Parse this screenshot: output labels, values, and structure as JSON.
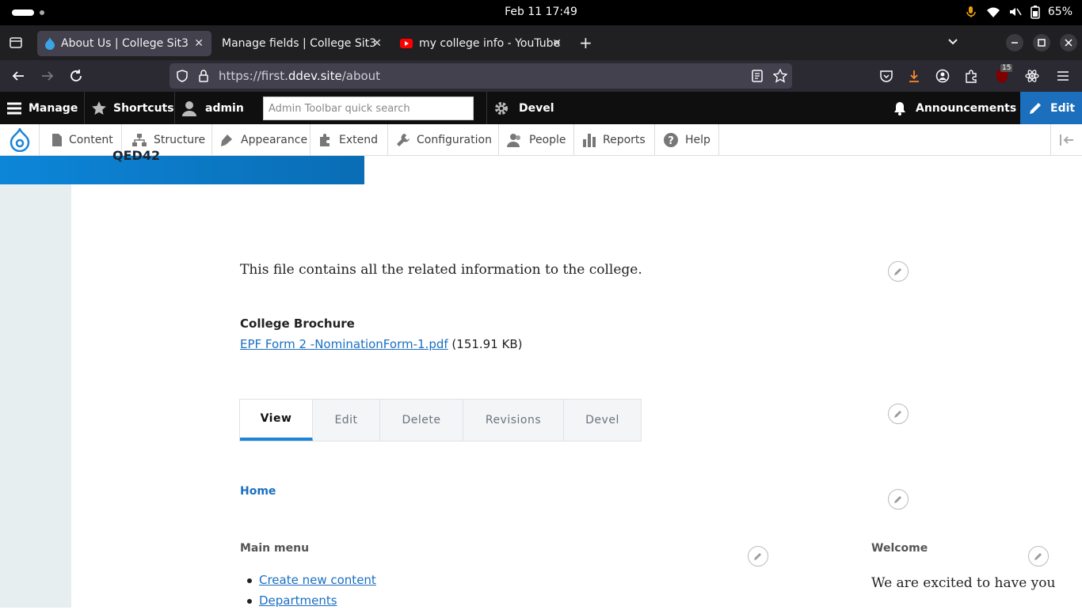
{
  "system": {
    "clock": "Feb 11  17:49",
    "battery": "65%"
  },
  "browser": {
    "tabs": [
      {
        "title": "About Us | College Sit3",
        "active": true
      },
      {
        "title": "Manage fields | College Sit3",
        "active": false
      },
      {
        "title": "my college info - YouTube",
        "active": false
      }
    ],
    "url_prefix": "https://first.",
    "url_host": "ddev.site",
    "url_path": "/about",
    "extension_badge": "15"
  },
  "toolbar": {
    "manage": "Manage",
    "shortcuts": "Shortcuts",
    "user": "admin",
    "search_placeholder": "Admin Toolbar quick search",
    "devel": "Devel",
    "announcements": "Announcements",
    "edit": "Edit"
  },
  "admin_menu": [
    "Content",
    "Structure",
    "Appearance",
    "Extend",
    "Configuration",
    "People",
    "Reports",
    "Help"
  ],
  "page": {
    "banner_text": "QED42",
    "body_text": "This file contains all the related information to the college.",
    "field_label": "College Brochure",
    "file_link": "EPF Form 2 -NominationForm-1.pdf",
    "file_size": "(151.91 KB)",
    "local_tabs": [
      "View",
      "Edit",
      "Delete",
      "Revisions",
      "Devel"
    ],
    "breadcrumb_home": "Home",
    "main_menu_title": "Main menu",
    "main_menu_items": [
      "Create new content",
      "Departments"
    ],
    "welcome_title": "Welcome",
    "welcome_text": "We are excited to have you"
  },
  "colors": {
    "accent": "#1d84d8",
    "link": "#1a6fc2",
    "toolbar_bg": "#0f0f0f",
    "edit_bg": "#1b6fbd",
    "sidebar_bg": "#e7eef0"
  }
}
